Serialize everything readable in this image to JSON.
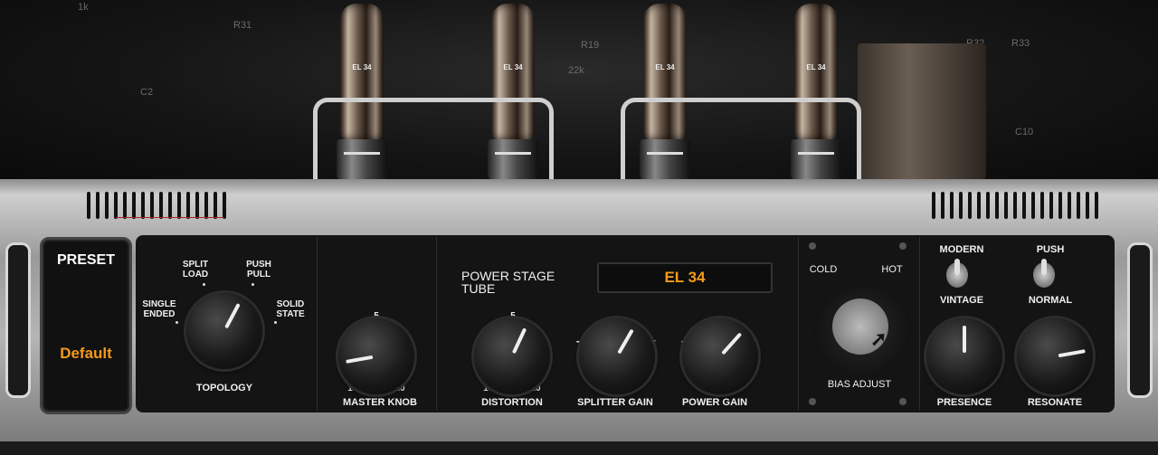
{
  "schematic": {
    "r31": "R31",
    "r32": "R32",
    "r33": "R33",
    "r19": "R19",
    "c2": "C2",
    "c10": "C10",
    "val22k": "22k",
    "val1k": "1k"
  },
  "tubes": [
    {
      "label": "EL 34"
    },
    {
      "label": "EL 34"
    },
    {
      "label": "EL 34"
    },
    {
      "label": "EL 34"
    }
  ],
  "preset": {
    "label": "PRESET",
    "value": "Default"
  },
  "topology": {
    "label": "TOPOLOGY",
    "options": [
      "SINGLE ENDED",
      "SPLIT LOAD",
      "PUSH PULL",
      "SOLID STATE"
    ],
    "selected": "SOLID STATE"
  },
  "master": {
    "label": "MASTER KNOB",
    "scale_min": "1",
    "scale_mid": "5",
    "scale_max": "10",
    "value": 3.2
  },
  "power_stage": {
    "label": "POWER STAGE TUBE",
    "value": "EL 34"
  },
  "distortion": {
    "label": "DISTORTION",
    "scale_min": "1",
    "scale_mid": "5",
    "scale_max": "10",
    "value": 6.5
  },
  "splitter_gain": {
    "label": "SPLITTER GAIN",
    "minus": "-",
    "plus": "+",
    "value": 0.62
  },
  "power_gain": {
    "label": "POWER GAIN",
    "minus": "-",
    "plus": "+",
    "value": 0.68
  },
  "bias": {
    "label": "BIAS ADJUST",
    "cold": "COLD",
    "hot": "HOT"
  },
  "switch1": {
    "top": "MODERN",
    "bottom": "VINTAGE",
    "position": "up"
  },
  "switch2": {
    "top": "PUSH",
    "bottom": "NORMAL",
    "position": "up"
  },
  "presence": {
    "label": "PRESENCE",
    "value": 0.5
  },
  "resonate": {
    "label": "RESONATE",
    "value": 0.82
  },
  "colors": {
    "accent": "#f39a1c",
    "panel": "#141414",
    "text": "#f0f0f0"
  }
}
